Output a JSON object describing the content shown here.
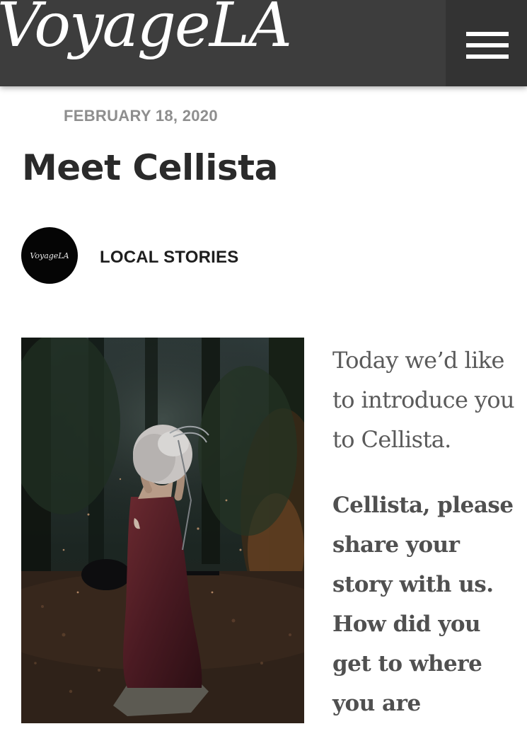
{
  "header": {
    "logo_text": "VoyageLA",
    "menu_icon": "hamburger-menu-icon"
  },
  "article": {
    "date": "FEBRUARY 18, 2020",
    "title": "Meet Cellista",
    "author": {
      "avatar_text": "VoyageLA",
      "category": "LOCAL STORIES"
    },
    "intro": "Today we’d like to introduce you to Cellista.",
    "question": "Cellista, please share your story with us. How did you get to where you are"
  },
  "colors": {
    "header_bg": "#3d3d3d",
    "menu_bg": "#333333",
    "date_text": "#8e8e8e",
    "title_text": "#2a2a2a",
    "body_text": "#5a5a5a"
  }
}
